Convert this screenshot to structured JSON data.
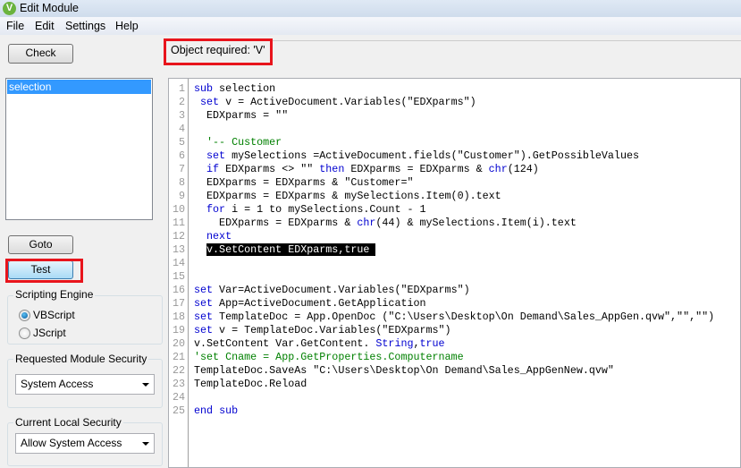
{
  "window": {
    "title": "Edit Module",
    "icon": "V"
  },
  "menu": [
    "File",
    "Edit",
    "Settings",
    "Help"
  ],
  "buttons": {
    "check": "Check",
    "goto": "Goto",
    "test": "Test"
  },
  "error_message": "Object required: 'V'",
  "module_list": [
    "selection"
  ],
  "scripting_engine": {
    "label": "Scripting Engine",
    "options": [
      "VBScript",
      "JScript"
    ],
    "selected": "VBScript"
  },
  "requested_security": {
    "label": "Requested Module Security",
    "value": "System Access"
  },
  "local_security": {
    "label": "Current Local Security",
    "value": "Allow System Access"
  },
  "colors": {
    "keyword": "#0000d0",
    "comment": "#008000",
    "highlight": "#e8141c",
    "selection": "#3399ff"
  },
  "code": [
    [
      [
        "sub",
        "kw"
      ],
      [
        " selection",
        "tx"
      ]
    ],
    [
      [
        " ",
        "tx"
      ],
      [
        "set",
        "kw"
      ],
      [
        " v = ActiveDocument.Variables(\"EDXparms\")",
        "tx"
      ]
    ],
    [
      [
        "  EDXparms = \"\"",
        "tx"
      ]
    ],
    [],
    [
      [
        "  '-- Customer",
        "cm"
      ]
    ],
    [
      [
        "  ",
        "tx"
      ],
      [
        "set",
        "kw"
      ],
      [
        " mySelections =ActiveDocument.fields(\"Customer\").GetPossibleValues",
        "tx"
      ]
    ],
    [
      [
        "  ",
        "tx"
      ],
      [
        "if",
        "kw"
      ],
      [
        " EDXparms <> \"\" ",
        "tx"
      ],
      [
        "then",
        "kw"
      ],
      [
        " EDXparms = EDXparms & ",
        "tx"
      ],
      [
        "chr",
        "kw"
      ],
      [
        "(124)",
        "tx"
      ]
    ],
    [
      [
        "  EDXparms = EDXparms & \"Customer=\"",
        "tx"
      ]
    ],
    [
      [
        "  EDXparms = EDXparms & mySelections.Item(0).text",
        "tx"
      ]
    ],
    [
      [
        "  ",
        "tx"
      ],
      [
        "for",
        "kw"
      ],
      [
        " i = 1 to mySelections.Count - 1",
        "tx"
      ]
    ],
    [
      [
        "    EDXparms = EDXparms & ",
        "tx"
      ],
      [
        "chr",
        "kw"
      ],
      [
        "(44) & mySelections.Item(i).text",
        "tx"
      ]
    ],
    [
      [
        "  ",
        "tx"
      ],
      [
        "next",
        "kw"
      ]
    ],
    [
      [
        "  ",
        "tx"
      ],
      [
        "v.SetContent EDXparms,true ",
        "hl"
      ]
    ],
    [],
    [],
    [
      [
        "set",
        "kw"
      ],
      [
        " Var=ActiveDocument.Variables(\"EDXparms\")",
        "tx"
      ]
    ],
    [
      [
        "set",
        "kw"
      ],
      [
        " App=ActiveDocument.GetApplication",
        "tx"
      ]
    ],
    [
      [
        "set",
        "kw"
      ],
      [
        " TemplateDoc = App.OpenDoc (\"C:\\Users\\Desktop\\On Demand\\Sales_AppGen.qvw\",\"\",\"\")",
        "tx"
      ]
    ],
    [
      [
        "set",
        "kw"
      ],
      [
        " v = TemplateDoc.Variables(\"EDXparms\")",
        "tx"
      ]
    ],
    [
      [
        "v.SetContent Var.GetContent. ",
        "tx"
      ],
      [
        "String",
        "kw"
      ],
      [
        ",",
        "tx"
      ],
      [
        "true",
        "kw"
      ]
    ],
    [
      [
        "'set Cname = App.GetProperties.Computername",
        "cm"
      ]
    ],
    [
      [
        "TemplateDoc.SaveAs \"C:\\Users\\Desktop\\On Demand\\Sales_AppGenNew.qvw\"",
        "tx"
      ]
    ],
    [
      [
        "TemplateDoc.Reload",
        "tx"
      ]
    ],
    [],
    [
      [
        "end",
        "kw"
      ],
      [
        " ",
        "tx"
      ],
      [
        "sub",
        "kw"
      ]
    ]
  ]
}
